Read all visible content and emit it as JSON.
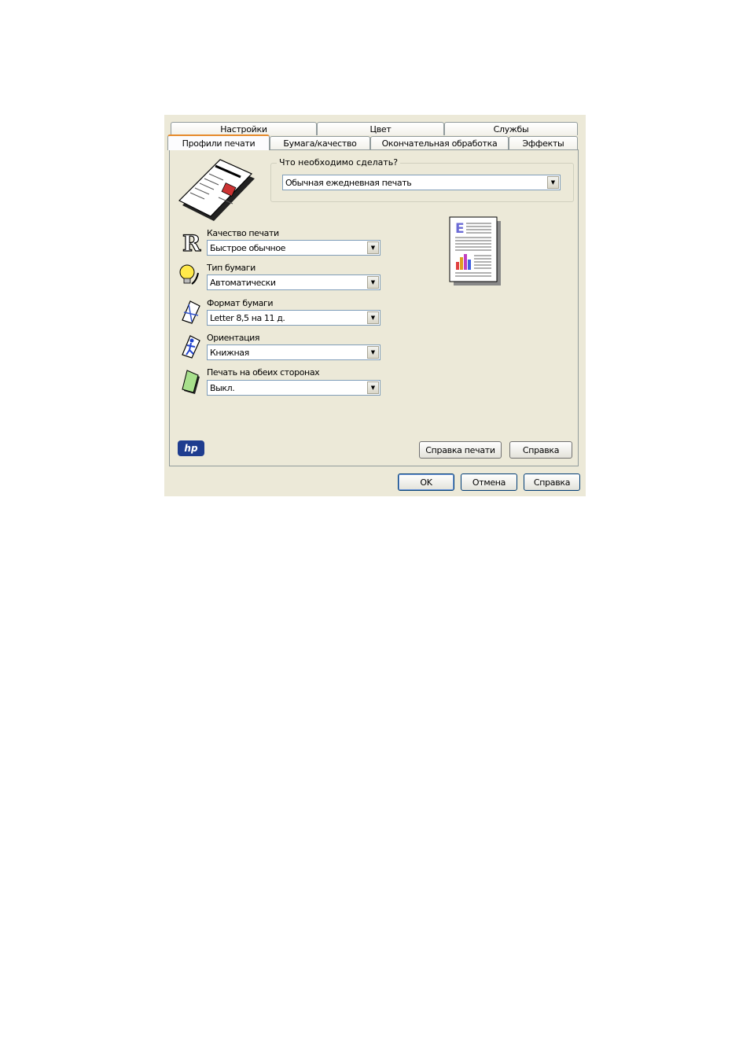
{
  "tabs_back": [
    "Настройки",
    "Цвет",
    "Службы"
  ],
  "tabs_front": [
    "Профили печати",
    "Бумага/качество",
    "Окончательная обработка",
    "Эффекты"
  ],
  "group": {
    "title": "Что необходимо сделать?",
    "value": "Обычная ежедневная печать"
  },
  "settings": [
    {
      "label": "Качество печати",
      "value": "Быстрое обычное",
      "icon": "print-quality-icon"
    },
    {
      "label": "Тип бумаги",
      "value": "Автоматически",
      "icon": "lightbulb-icon"
    },
    {
      "label": "Формат бумаги",
      "value": "Letter 8,5 на 11 д.",
      "icon": "paper-size-icon"
    },
    {
      "label": "Ориентация",
      "value": "Книжная",
      "icon": "orientation-icon"
    },
    {
      "label": "Печать на обеих сторонах",
      "value": "Выкл.",
      "icon": "duplex-icon"
    }
  ],
  "logo": "hp",
  "panel_buttons": {
    "print_help": "Справка печати",
    "help": "Справка"
  },
  "dialog_buttons": {
    "ok": "OK",
    "cancel": "Отмена",
    "help": "Справка"
  },
  "colors": {
    "dialog_bg": "#ece9d8",
    "tab_active_accent": "#e68b2c",
    "hp_blue": "#1f3d8f"
  }
}
